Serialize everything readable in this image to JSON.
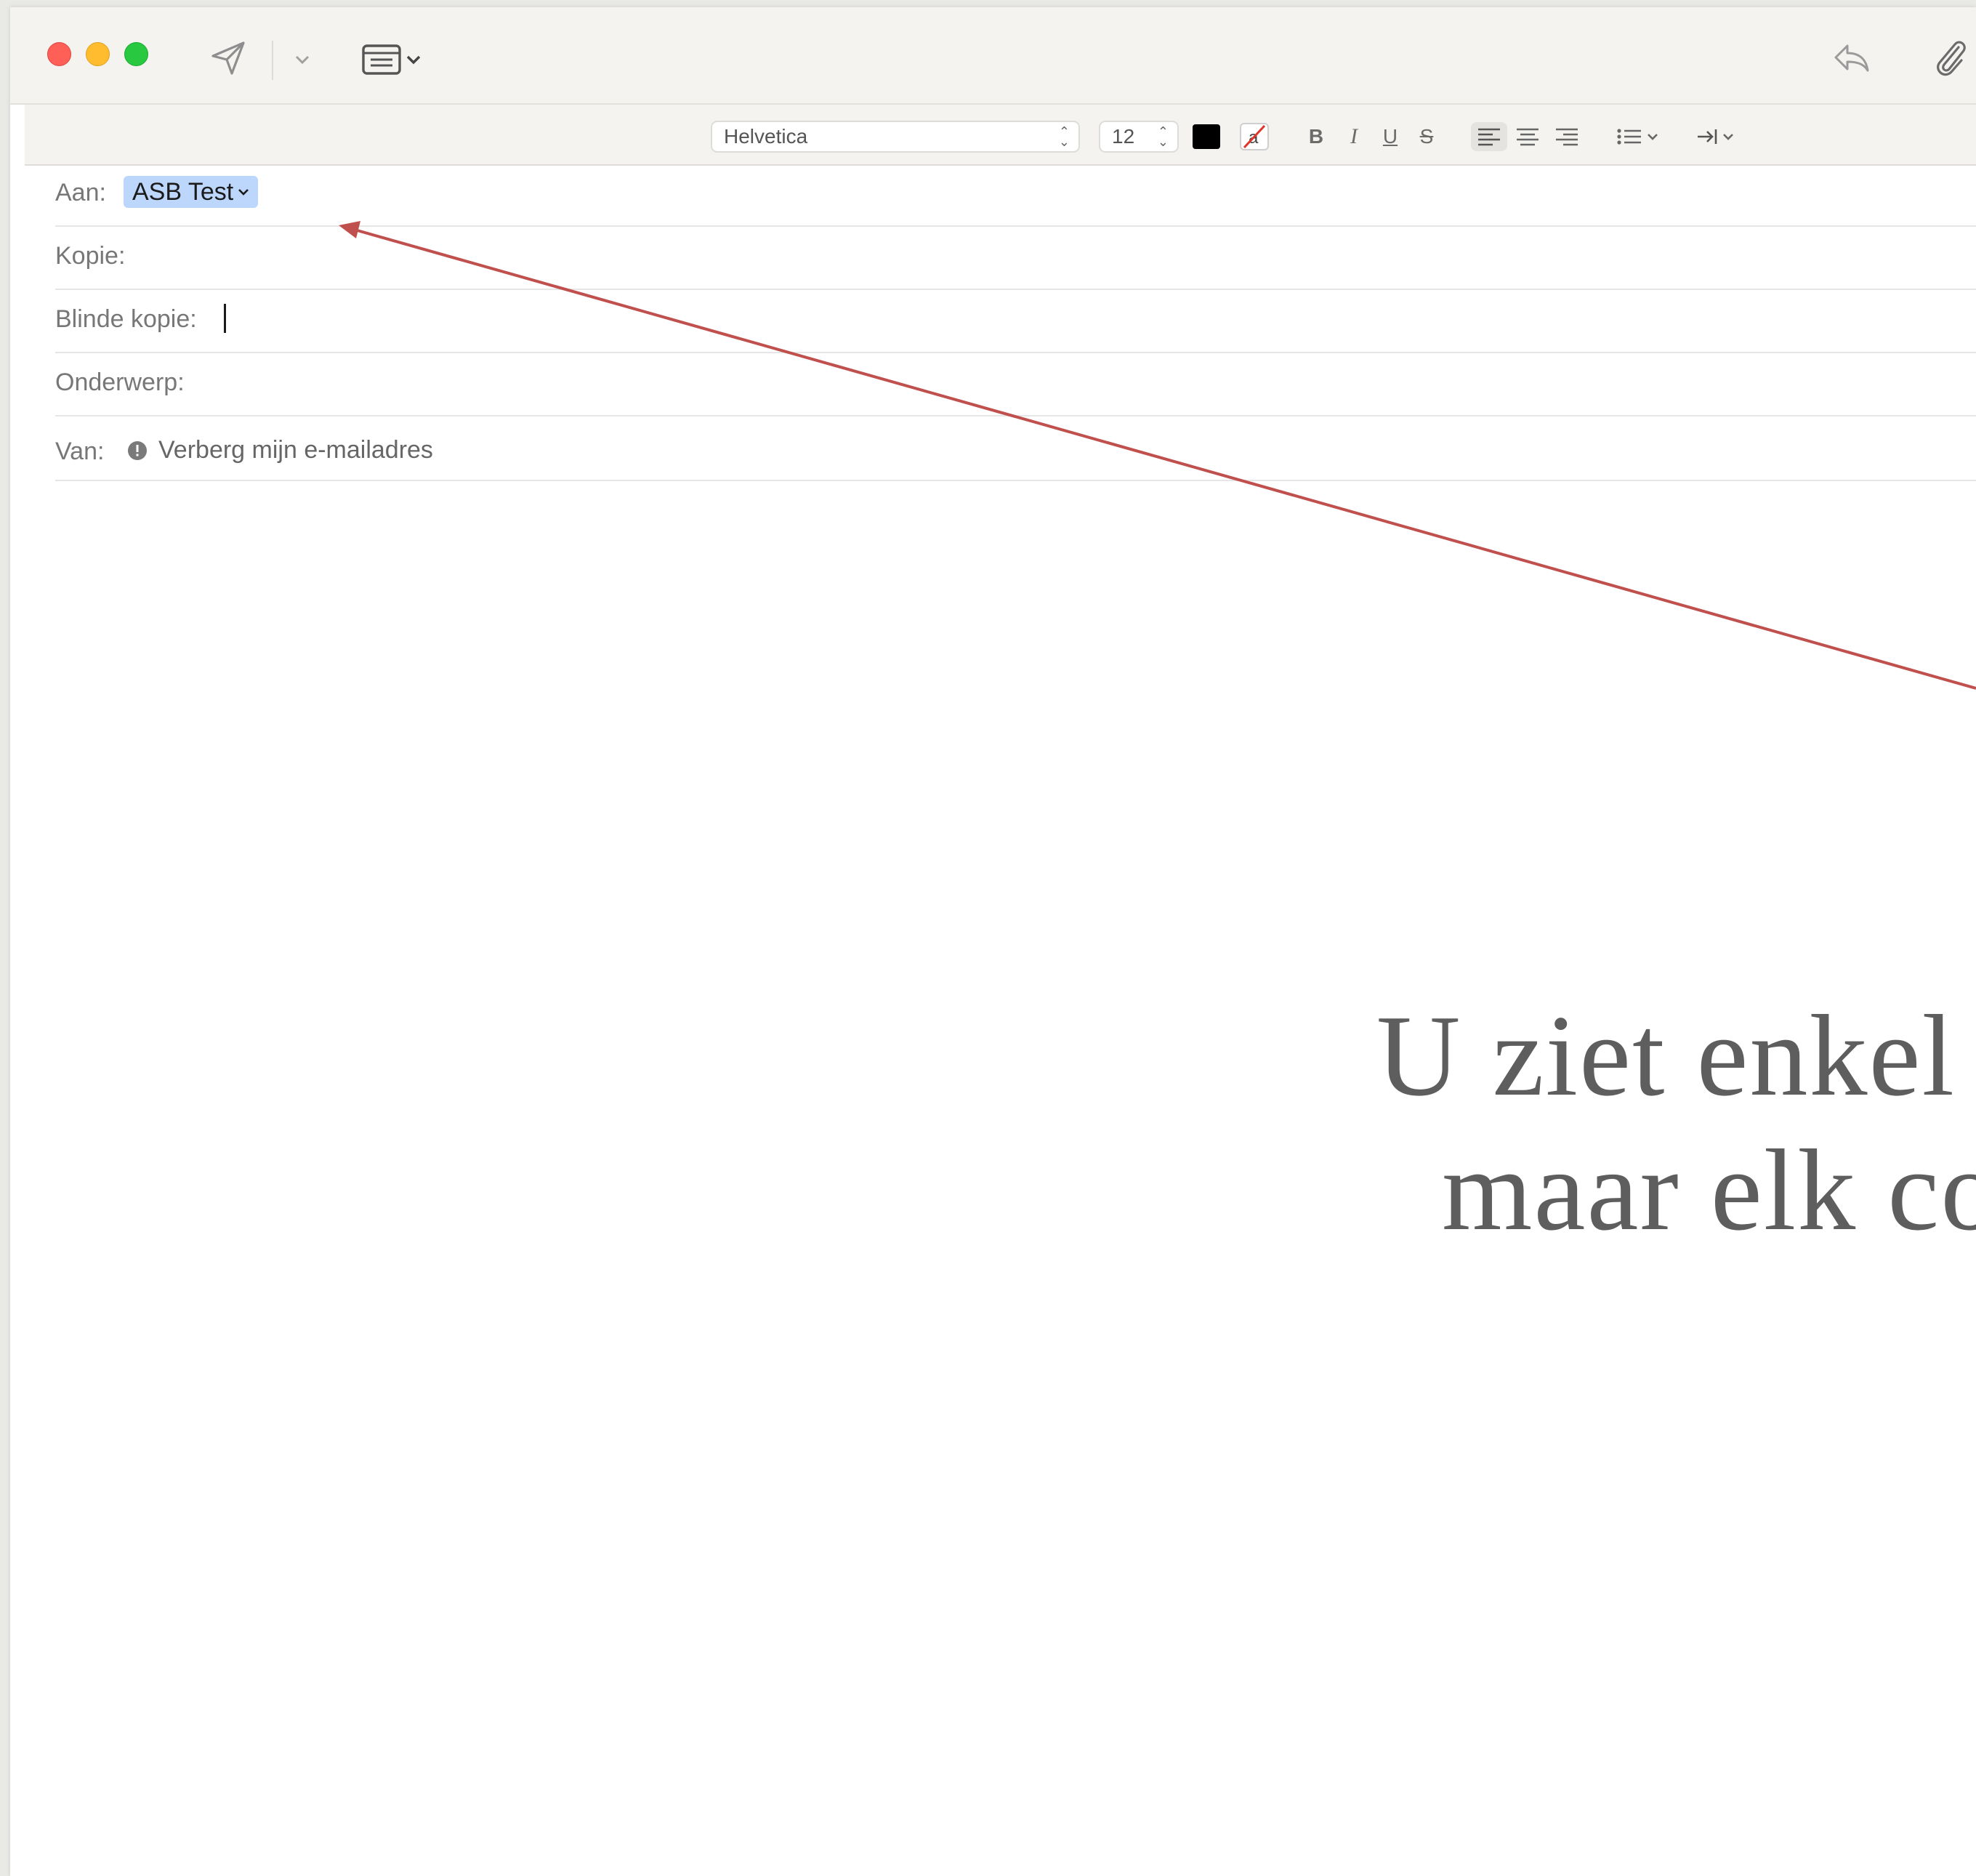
{
  "toolbar": {
    "send_icon": "paper-plane-icon",
    "dropdown_icon": "chevron-down-icon",
    "header_fields_icon": "header-fields-icon",
    "reply_icon": "reply-arrow-icon",
    "attach_icon": "paperclip-icon"
  },
  "format": {
    "font": "Helvetica",
    "size": "12",
    "text_color": "#000000",
    "bold": "B",
    "italic": "I",
    "underline": "U",
    "strike": "S",
    "text_color_swatch_icon": "color-swatch-icon",
    "background_color_icon": "background-color-icon",
    "align_left_icon": "align-left-icon",
    "align_center_icon": "align-center-icon",
    "align_right_icon": "align-right-icon",
    "list_icon": "bullet-list-icon",
    "indent_icon": "indent-icon"
  },
  "headers": {
    "to_label": "Aan:",
    "to_value": "ASB Test",
    "cc_label": "Kopie:",
    "bcc_label": "Blinde kopie:",
    "subject_label": "Onderwerp:",
    "from_label": "Van:",
    "from_value": "Verberg mijn e-mailadres",
    "from_icon": "info-circle-icon"
  },
  "annotation": {
    "line1": "U ziet enkel d",
    "line2": "maar elk co",
    "arrow_color": "#c0504d"
  },
  "colors": {
    "token_bg": "#bcd7fb",
    "toolbar_bg": "#f4f3ef"
  }
}
